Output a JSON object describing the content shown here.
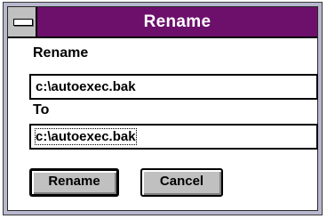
{
  "window": {
    "title": "Rename"
  },
  "form": {
    "from_label": "Rename",
    "from_value": "c:\\autoexec.bak",
    "to_label": "To",
    "to_value": "c:\\autoexec.bak"
  },
  "buttons": {
    "rename_label": "Rename",
    "cancel_label": "Cancel"
  },
  "colors": {
    "titlebar": "#6c106c",
    "button_face": "#c0c0c0",
    "frame": "#b7b7ce"
  },
  "icons": {
    "system_menu": "system-menu-icon"
  }
}
